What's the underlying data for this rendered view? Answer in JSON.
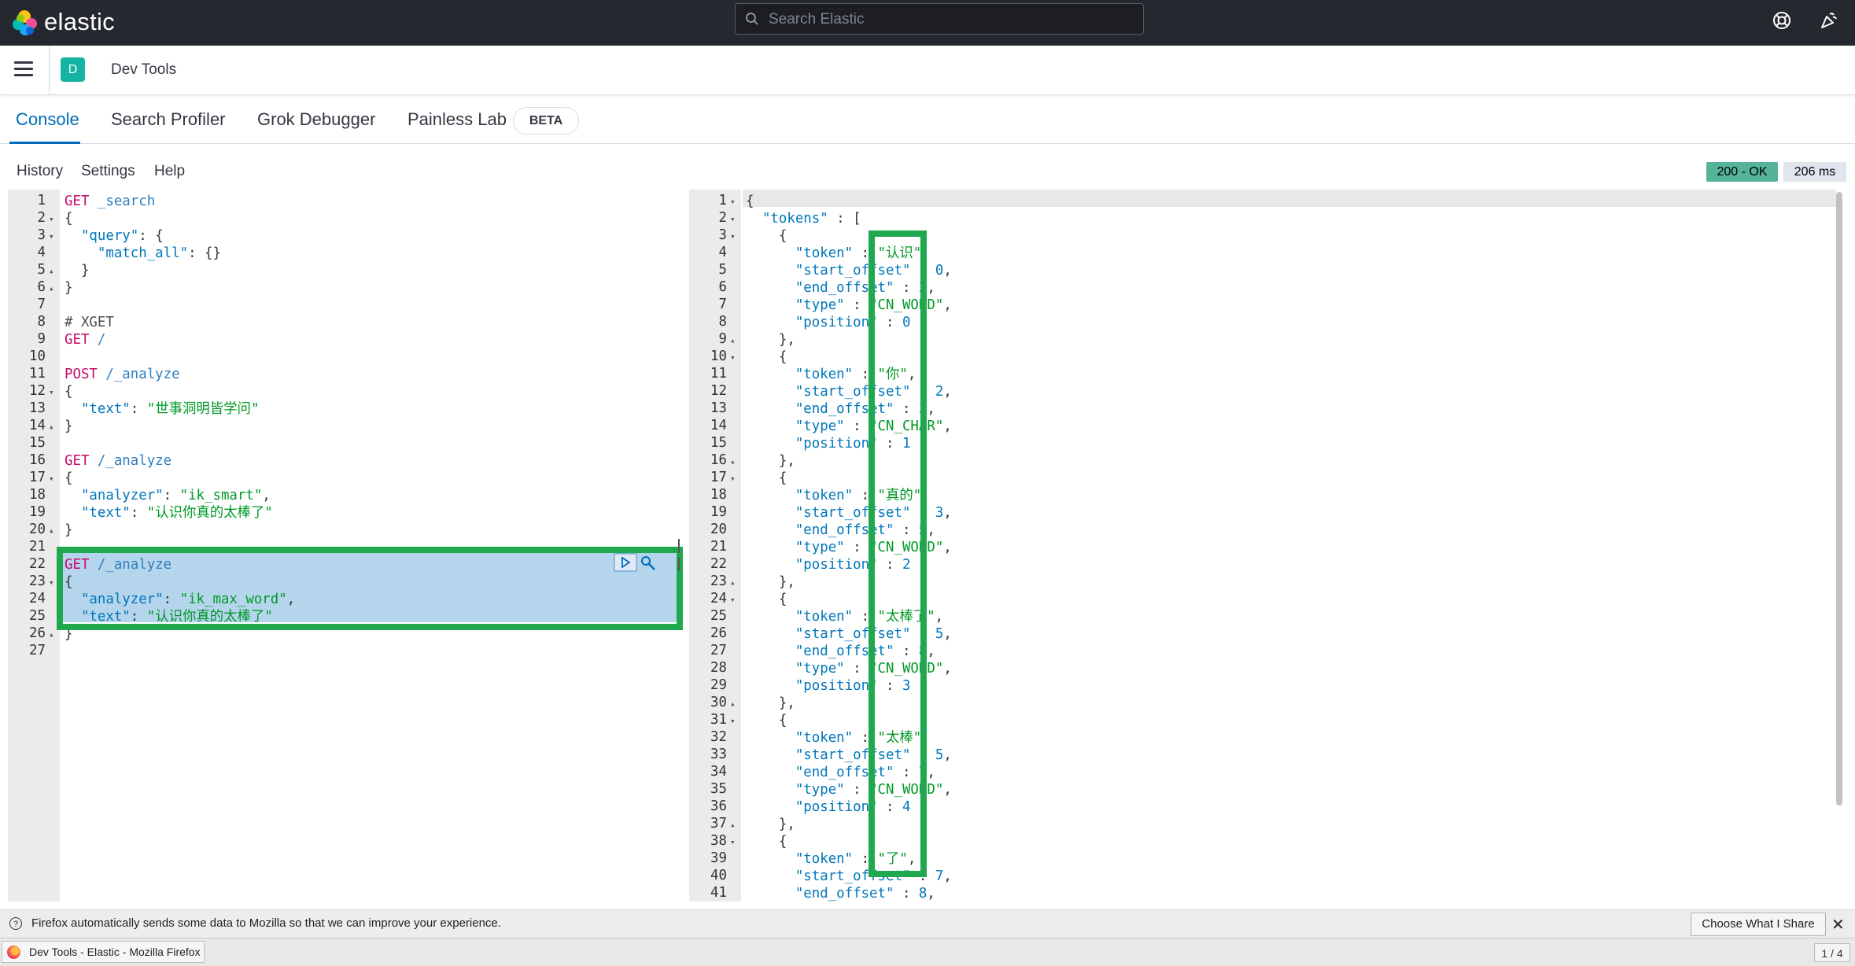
{
  "header": {
    "brand": "elastic",
    "search_placeholder": "Search Elastic",
    "help_icon": "help-icon",
    "news_icon": "newsfeed-icon"
  },
  "appbar": {
    "avatar_letter": "D",
    "breadcrumb": "Dev Tools"
  },
  "tabs": [
    "Console",
    "Search Profiler",
    "Grok Debugger",
    "Painless Lab"
  ],
  "beta_badge": "BETA",
  "console_menu": [
    "History",
    "Settings",
    "Help"
  ],
  "status": {
    "code": "200 - OK",
    "time": "206 ms"
  },
  "request_lines": [
    [
      [
        "method",
        "GET"
      ],
      [
        "url",
        " _search"
      ]
    ],
    [
      [
        "punc",
        "{"
      ]
    ],
    [
      [
        "punc",
        "  "
      ],
      [
        "key",
        "\"query\""
      ],
      [
        "punc",
        ": {"
      ]
    ],
    [
      [
        "punc",
        "    "
      ],
      [
        "key",
        "\"match_all\""
      ],
      [
        "punc",
        ": {}"
      ]
    ],
    [
      [
        "punc",
        "  }"
      ]
    ],
    [
      [
        "punc",
        "}"
      ]
    ],
    [],
    [
      [
        "cmt",
        "# XGET"
      ]
    ],
    [
      [
        "method",
        "GET"
      ],
      [
        "url",
        " /"
      ]
    ],
    [],
    [
      [
        "method",
        "POST"
      ],
      [
        "url",
        " /_analyze"
      ]
    ],
    [
      [
        "punc",
        "{"
      ]
    ],
    [
      [
        "punc",
        "  "
      ],
      [
        "key",
        "\"text\""
      ],
      [
        "punc",
        ": "
      ],
      [
        "str",
        "\"世事洞明皆学问\""
      ]
    ],
    [
      [
        "punc",
        "}"
      ]
    ],
    [],
    [
      [
        "method",
        "GET"
      ],
      [
        "url",
        " /_analyze"
      ]
    ],
    [
      [
        "punc",
        "{"
      ]
    ],
    [
      [
        "punc",
        "  "
      ],
      [
        "key",
        "\"analyzer\""
      ],
      [
        "punc",
        ": "
      ],
      [
        "str",
        "\"ik_smart\""
      ],
      [
        "punc",
        ","
      ]
    ],
    [
      [
        "punc",
        "  "
      ],
      [
        "key",
        "\"text\""
      ],
      [
        "punc",
        ": "
      ],
      [
        "str",
        "\"认识你真的太棒了\""
      ]
    ],
    [
      [
        "punc",
        "}"
      ]
    ],
    [],
    [
      [
        "method",
        "GET"
      ],
      [
        "url",
        " /_analyze"
      ]
    ],
    [
      [
        "punc",
        "{"
      ]
    ],
    [
      [
        "punc",
        "  "
      ],
      [
        "key",
        "\"analyzer\""
      ],
      [
        "punc",
        ": "
      ],
      [
        "str",
        "\"ik_max_word\""
      ],
      [
        "punc",
        ","
      ]
    ],
    [
      [
        "punc",
        "  "
      ],
      [
        "key",
        "\"text\""
      ],
      [
        "punc",
        ": "
      ],
      [
        "str",
        "\"认识你真的太棒了\""
      ]
    ],
    [
      [
        "punc",
        "}"
      ]
    ],
    []
  ],
  "request_folds": {
    "2": "down",
    "3": "down",
    "5": "up",
    "6": "up",
    "12": "down",
    "14": "up",
    "17": "down",
    "20": "up",
    "23": "down",
    "26": "up"
  },
  "response_lines": [
    [
      [
        "punc",
        "{"
      ]
    ],
    [
      [
        "punc",
        "  "
      ],
      [
        "key",
        "\"tokens\""
      ],
      [
        "punc",
        " : ["
      ]
    ],
    [
      [
        "punc",
        "    {"
      ]
    ],
    [
      [
        "punc",
        "      "
      ],
      [
        "key",
        "\"token\""
      ],
      [
        "punc",
        " : "
      ],
      [
        "str",
        "\"认识\""
      ],
      [
        "punc",
        ","
      ]
    ],
    [
      [
        "punc",
        "      "
      ],
      [
        "key",
        "\"start_offset\""
      ],
      [
        "punc",
        " : "
      ],
      [
        "num",
        "0"
      ],
      [
        "punc",
        ","
      ]
    ],
    [
      [
        "punc",
        "      "
      ],
      [
        "key",
        "\"end_offset\""
      ],
      [
        "punc",
        " : "
      ],
      [
        "num",
        "2"
      ],
      [
        "punc",
        ","
      ]
    ],
    [
      [
        "punc",
        "      "
      ],
      [
        "key",
        "\"type\""
      ],
      [
        "punc",
        " : "
      ],
      [
        "str",
        "\"CN_WORD\""
      ],
      [
        "punc",
        ","
      ]
    ],
    [
      [
        "punc",
        "      "
      ],
      [
        "key",
        "\"position\""
      ],
      [
        "punc",
        " : "
      ],
      [
        "num",
        "0"
      ]
    ],
    [
      [
        "punc",
        "    },"
      ]
    ],
    [
      [
        "punc",
        "    {"
      ]
    ],
    [
      [
        "punc",
        "      "
      ],
      [
        "key",
        "\"token\""
      ],
      [
        "punc",
        " : "
      ],
      [
        "str",
        "\"你\""
      ],
      [
        "punc",
        ","
      ]
    ],
    [
      [
        "punc",
        "      "
      ],
      [
        "key",
        "\"start_offset\""
      ],
      [
        "punc",
        " : "
      ],
      [
        "num",
        "2"
      ],
      [
        "punc",
        ","
      ]
    ],
    [
      [
        "punc",
        "      "
      ],
      [
        "key",
        "\"end_offset\""
      ],
      [
        "punc",
        " : "
      ],
      [
        "num",
        "3"
      ],
      [
        "punc",
        ","
      ]
    ],
    [
      [
        "punc",
        "      "
      ],
      [
        "key",
        "\"type\""
      ],
      [
        "punc",
        " : "
      ],
      [
        "str",
        "\"CN_CHAR\""
      ],
      [
        "punc",
        ","
      ]
    ],
    [
      [
        "punc",
        "      "
      ],
      [
        "key",
        "\"position\""
      ],
      [
        "punc",
        " : "
      ],
      [
        "num",
        "1"
      ]
    ],
    [
      [
        "punc",
        "    },"
      ]
    ],
    [
      [
        "punc",
        "    {"
      ]
    ],
    [
      [
        "punc",
        "      "
      ],
      [
        "key",
        "\"token\""
      ],
      [
        "punc",
        " : "
      ],
      [
        "str",
        "\"真的\""
      ],
      [
        "punc",
        ","
      ]
    ],
    [
      [
        "punc",
        "      "
      ],
      [
        "key",
        "\"start_offset\""
      ],
      [
        "punc",
        " : "
      ],
      [
        "num",
        "3"
      ],
      [
        "punc",
        ","
      ]
    ],
    [
      [
        "punc",
        "      "
      ],
      [
        "key",
        "\"end_offset\""
      ],
      [
        "punc",
        " : "
      ],
      [
        "num",
        "5"
      ],
      [
        "punc",
        ","
      ]
    ],
    [
      [
        "punc",
        "      "
      ],
      [
        "key",
        "\"type\""
      ],
      [
        "punc",
        " : "
      ],
      [
        "str",
        "\"CN_WORD\""
      ],
      [
        "punc",
        ","
      ]
    ],
    [
      [
        "punc",
        "      "
      ],
      [
        "key",
        "\"position\""
      ],
      [
        "punc",
        " : "
      ],
      [
        "num",
        "2"
      ]
    ],
    [
      [
        "punc",
        "    },"
      ]
    ],
    [
      [
        "punc",
        "    {"
      ]
    ],
    [
      [
        "punc",
        "      "
      ],
      [
        "key",
        "\"token\""
      ],
      [
        "punc",
        " : "
      ],
      [
        "str",
        "\"太棒了\""
      ],
      [
        "punc",
        ","
      ]
    ],
    [
      [
        "punc",
        "      "
      ],
      [
        "key",
        "\"start_offset\""
      ],
      [
        "punc",
        " : "
      ],
      [
        "num",
        "5"
      ],
      [
        "punc",
        ","
      ]
    ],
    [
      [
        "punc",
        "      "
      ],
      [
        "key",
        "\"end_offset\""
      ],
      [
        "punc",
        " : "
      ],
      [
        "num",
        "8"
      ],
      [
        "punc",
        ","
      ]
    ],
    [
      [
        "punc",
        "      "
      ],
      [
        "key",
        "\"type\""
      ],
      [
        "punc",
        " : "
      ],
      [
        "str",
        "\"CN_WORD\""
      ],
      [
        "punc",
        ","
      ]
    ],
    [
      [
        "punc",
        "      "
      ],
      [
        "key",
        "\"position\""
      ],
      [
        "punc",
        " : "
      ],
      [
        "num",
        "3"
      ]
    ],
    [
      [
        "punc",
        "    },"
      ]
    ],
    [
      [
        "punc",
        "    {"
      ]
    ],
    [
      [
        "punc",
        "      "
      ],
      [
        "key",
        "\"token\""
      ],
      [
        "punc",
        " : "
      ],
      [
        "str",
        "\"太棒\""
      ],
      [
        "punc",
        ","
      ]
    ],
    [
      [
        "punc",
        "      "
      ],
      [
        "key",
        "\"start_offset\""
      ],
      [
        "punc",
        " : "
      ],
      [
        "num",
        "5"
      ],
      [
        "punc",
        ","
      ]
    ],
    [
      [
        "punc",
        "      "
      ],
      [
        "key",
        "\"end_offset\""
      ],
      [
        "punc",
        " : "
      ],
      [
        "num",
        "7"
      ],
      [
        "punc",
        ","
      ]
    ],
    [
      [
        "punc",
        "      "
      ],
      [
        "key",
        "\"type\""
      ],
      [
        "punc",
        " : "
      ],
      [
        "str",
        "\"CN_WORD\""
      ],
      [
        "punc",
        ","
      ]
    ],
    [
      [
        "punc",
        "      "
      ],
      [
        "key",
        "\"position\""
      ],
      [
        "punc",
        " : "
      ],
      [
        "num",
        "4"
      ]
    ],
    [
      [
        "punc",
        "    },"
      ]
    ],
    [
      [
        "punc",
        "    {"
      ]
    ],
    [
      [
        "punc",
        "      "
      ],
      [
        "key",
        "\"token\""
      ],
      [
        "punc",
        " : "
      ],
      [
        "str",
        "\"了\""
      ],
      [
        "punc",
        ","
      ]
    ],
    [
      [
        "punc",
        "      "
      ],
      [
        "key",
        "\"start_offset\""
      ],
      [
        "punc",
        " : "
      ],
      [
        "num",
        "7"
      ],
      [
        "punc",
        ","
      ]
    ],
    [
      [
        "punc",
        "      "
      ],
      [
        "key",
        "\"end_offset\""
      ],
      [
        "punc",
        " : "
      ],
      [
        "num",
        "8"
      ],
      [
        "punc",
        ","
      ]
    ]
  ],
  "response_folds": {
    "1": "down",
    "2": "down",
    "3": "down",
    "9": "up",
    "10": "down",
    "16": "up",
    "17": "down",
    "23": "up",
    "24": "down",
    "30": "up",
    "31": "down",
    "37": "up",
    "38": "down"
  },
  "firefox": {
    "notification": "Firefox automatically sends some data to Mozilla so that we can improve your experience.",
    "notification_button": "Choose What I Share",
    "close_glyph": "✕",
    "task_title": "Dev Tools - Elastic - Mozilla Firefox",
    "pager": "1 / 4"
  }
}
